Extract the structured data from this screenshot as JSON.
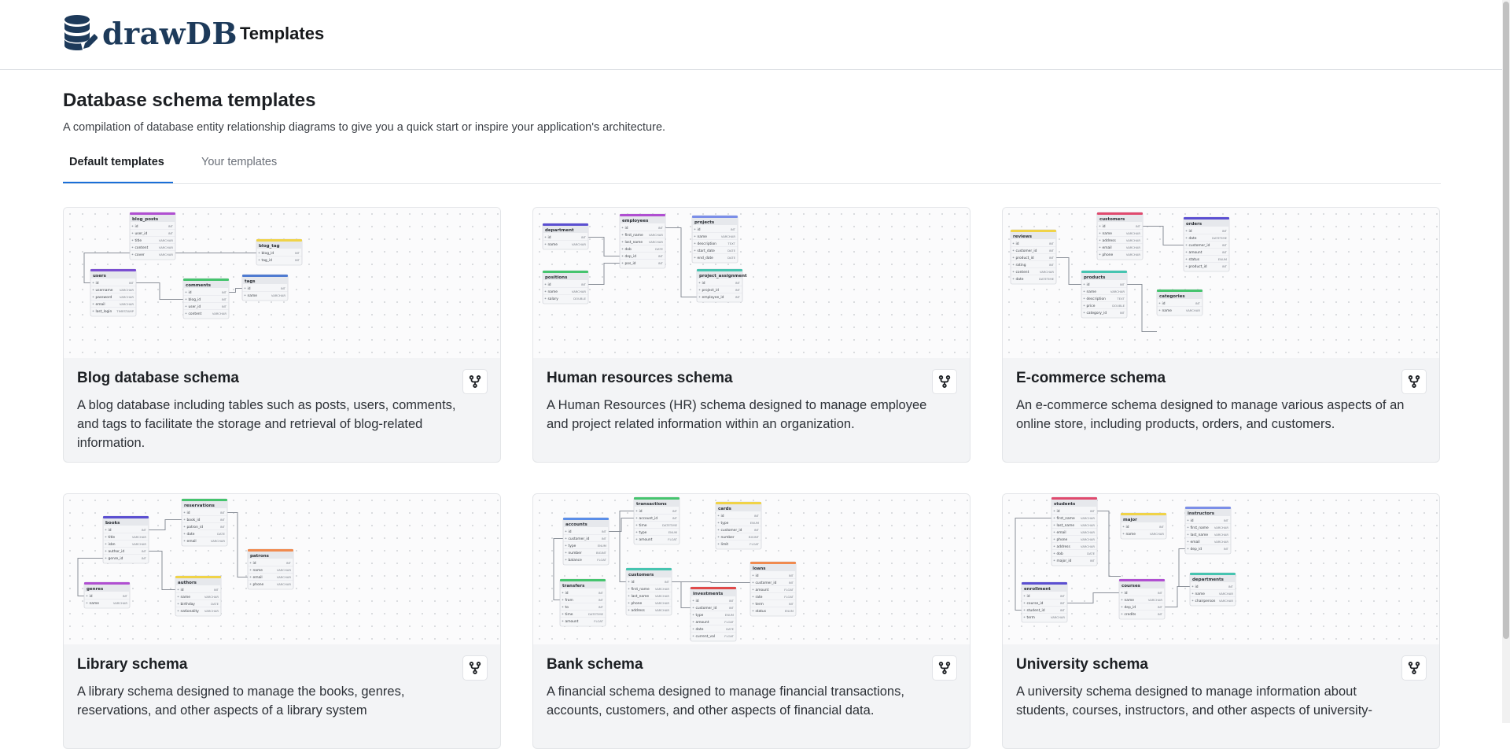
{
  "header": {
    "logo_text": "drawDB",
    "nav_title": "Templates"
  },
  "page": {
    "title": "Database schema templates",
    "subtitle": "A compilation of database entity relationship diagrams to give you a quick start or inspire your application's architecture."
  },
  "tabs": [
    {
      "label": "Default templates",
      "active": true
    },
    {
      "label": "Your templates",
      "active": false
    }
  ],
  "colors": {
    "accent": "#1a6fd8",
    "brand": "#1d3a5a"
  },
  "cards": [
    {
      "title": "Blog database schema",
      "description": "A blog database including tables such as posts, users, comments, and tags to facilitate the storage and retrieval of blog-related information.",
      "action_icon": "fork-icon",
      "tables": [
        {
          "name": "blog_posts",
          "color": "#b04fd1",
          "fields": [
            [
              "id",
              "INT"
            ],
            [
              "user_id",
              "INT"
            ],
            [
              "title",
              "VARCHAR"
            ],
            [
              "content",
              "VARCHAR"
            ],
            [
              "cover",
              "VARCHAR"
            ]
          ]
        },
        {
          "name": "blog_tag",
          "color": "#f0d348",
          "fields": [
            [
              "blog_id",
              "INT"
            ],
            [
              "tag_id",
              "INT"
            ]
          ]
        },
        {
          "name": "users",
          "color": "#7b4fd1",
          "fields": [
            [
              "id",
              "INT"
            ],
            [
              "username",
              "VARCHAR"
            ],
            [
              "password",
              "VARCHAR"
            ],
            [
              "email",
              "VARCHAR"
            ],
            [
              "last_login",
              "TIMESTAMP"
            ]
          ]
        },
        {
          "name": "comments",
          "color": "#46c46e",
          "fields": [
            [
              "id",
              "INT"
            ],
            [
              "blog_id",
              "INT"
            ],
            [
              "user_id",
              "INT"
            ],
            [
              "content",
              "VARCHAR"
            ]
          ]
        },
        {
          "name": "tags",
          "color": "#4f7bd1",
          "fields": [
            [
              "id",
              "INT"
            ],
            [
              "name",
              "VARCHAR"
            ]
          ]
        }
      ]
    },
    {
      "title": "Human resources schema",
      "description": "A Human Resources (HR) schema designed to manage employee and project related information within an organization.",
      "action_icon": "fork-icon",
      "tables": [
        {
          "name": "department",
          "color": "#5b4fd1",
          "fields": [
            [
              "id",
              "INT"
            ],
            [
              "name",
              "VARCHAR"
            ]
          ]
        },
        {
          "name": "employees",
          "color": "#b04fd1",
          "fields": [
            [
              "id",
              "INT"
            ],
            [
              "first_name",
              "VARCHAR"
            ],
            [
              "last_name",
              "VARCHAR"
            ],
            [
              "dob",
              "DATE"
            ],
            [
              "dep_id",
              "INT"
            ],
            [
              "pos_id",
              "INT"
            ]
          ]
        },
        {
          "name": "projects",
          "color": "#7b8ee8",
          "fields": [
            [
              "id",
              "INT"
            ],
            [
              "name",
              "VARCHAR"
            ],
            [
              "description",
              "TEXT"
            ],
            [
              "start_date",
              "DATE"
            ],
            [
              "end_date",
              "DATE"
            ]
          ]
        },
        {
          "name": "positions",
          "color": "#46c46e",
          "fields": [
            [
              "id",
              "INT"
            ],
            [
              "name",
              "VARCHAR"
            ],
            [
              "salary",
              "DOUBLE"
            ]
          ]
        },
        {
          "name": "project_assignment",
          "color": "#46c4b0",
          "fields": [
            [
              "id",
              "INT"
            ],
            [
              "project_id",
              "INT"
            ],
            [
              "employee_id",
              "INT"
            ]
          ]
        }
      ]
    },
    {
      "title": "E-commerce schema",
      "description": "An e-commerce schema designed to manage various aspects of an online store, including products, orders, and customers.",
      "action_icon": "fork-icon",
      "tables": [
        {
          "name": "customers",
          "color": "#e04a6e",
          "fields": [
            [
              "id",
              "INT"
            ],
            [
              "name",
              "VARCHAR"
            ],
            [
              "address",
              "VARCHAR"
            ],
            [
              "email",
              "VARCHAR"
            ],
            [
              "phone",
              "VARCHAR"
            ]
          ]
        },
        {
          "name": "orders",
          "color": "#5b4fd1",
          "fields": [
            [
              "id",
              "INT"
            ],
            [
              "date",
              "DATETIME"
            ],
            [
              "customer_id",
              "INT"
            ],
            [
              "amount",
              "INT"
            ],
            [
              "status",
              "ENUM"
            ],
            [
              "product_id",
              "INT"
            ]
          ]
        },
        {
          "name": "reviews",
          "color": "#f0d348",
          "fields": [
            [
              "id",
              "INT"
            ],
            [
              "customer_id",
              "INT"
            ],
            [
              "product_id",
              "INT"
            ],
            [
              "rating",
              "INT"
            ],
            [
              "content",
              "VARCHAR"
            ],
            [
              "date",
              "DATETIME"
            ]
          ]
        },
        {
          "name": "products",
          "color": "#46c4b0",
          "fields": [
            [
              "id",
              "INT"
            ],
            [
              "name",
              "VARCHAR"
            ],
            [
              "description",
              "TEXT"
            ],
            [
              "price",
              "DOUBLE"
            ],
            [
              "category_id",
              "INT"
            ]
          ]
        },
        {
          "name": "categories",
          "color": "#46c46e",
          "fields": [
            [
              "id",
              "INT"
            ],
            [
              "name",
              "VARCHAR"
            ]
          ]
        }
      ]
    },
    {
      "title": "Library schema",
      "description": "A library schema designed to manage the books, genres, reservations, and other aspects of a library system",
      "action_icon": "fork-icon",
      "tables": [
        {
          "name": "reservations",
          "color": "#46c46e",
          "fields": [
            [
              "id",
              "INT"
            ],
            [
              "book_id",
              "INT"
            ],
            [
              "patron_id",
              "INT"
            ],
            [
              "date",
              "DATE"
            ],
            [
              "email",
              "VARCHAR"
            ]
          ]
        },
        {
          "name": "books",
          "color": "#5b4fd1",
          "fields": [
            [
              "id",
              "INT"
            ],
            [
              "title",
              "VARCHAR"
            ],
            [
              "isbn",
              "VARCHAR"
            ],
            [
              "author_id",
              "INT"
            ],
            [
              "genre_id",
              "INT"
            ]
          ]
        },
        {
          "name": "patrons",
          "color": "#f08a4f",
          "fields": [
            [
              "id",
              "INT"
            ],
            [
              "name",
              "VARCHAR"
            ],
            [
              "email",
              "VARCHAR"
            ],
            [
              "phone",
              "VARCHAR"
            ]
          ]
        },
        {
          "name": "authors",
          "color": "#f0d348",
          "fields": [
            [
              "id",
              "INT"
            ],
            [
              "name",
              "VARCHAR"
            ],
            [
              "birthday",
              "DATE"
            ],
            [
              "nationality",
              "VARCHAR"
            ]
          ]
        },
        {
          "name": "genres",
          "color": "#b04fd1",
          "fields": [
            [
              "id",
              "INT"
            ],
            [
              "name",
              "VARCHAR"
            ]
          ]
        }
      ]
    },
    {
      "title": "Bank schema",
      "description": "A financial schema designed to manage financial transactions, accounts, customers, and other aspects of financial data.",
      "action_icon": "fork-icon",
      "tables": [
        {
          "name": "transactions",
          "color": "#46c46e",
          "fields": [
            [
              "id",
              "INT"
            ],
            [
              "account_id",
              "INT"
            ],
            [
              "time",
              "DATETIME"
            ],
            [
              "type",
              "ENUM"
            ],
            [
              "amount",
              "FLOAT"
            ]
          ]
        },
        {
          "name": "accounts",
          "color": "#5b8ee8",
          "fields": [
            [
              "id",
              "INT"
            ],
            [
              "customer_id",
              "INT"
            ],
            [
              "type",
              "ENUM"
            ],
            [
              "number",
              "BIGINT"
            ],
            [
              "balance",
              "FLOAT"
            ]
          ]
        },
        {
          "name": "cards",
          "color": "#f0d348",
          "fields": [
            [
              "id",
              "INT"
            ],
            [
              "type",
              "ENUM"
            ],
            [
              "customer_id",
              "INT"
            ],
            [
              "number",
              "BIGINT"
            ],
            [
              "limit",
              "FLOAT"
            ]
          ]
        },
        {
          "name": "customers",
          "color": "#46c4b0",
          "fields": [
            [
              "id",
              "INT"
            ],
            [
              "first_name",
              "VARCHAR"
            ],
            [
              "last_name",
              "VARCHAR"
            ],
            [
              "phone",
              "VARCHAR"
            ],
            [
              "address",
              "VARCHAR"
            ]
          ]
        },
        {
          "name": "loans",
          "color": "#f08a4f",
          "fields": [
            [
              "id",
              "INT"
            ],
            [
              "customer_id",
              "INT"
            ],
            [
              "amount",
              "FLOAT"
            ],
            [
              "rate",
              "FLOAT"
            ],
            [
              "term",
              "INT"
            ],
            [
              "status",
              "ENUM"
            ]
          ]
        },
        {
          "name": "transfers",
          "color": "#46c46e",
          "fields": [
            [
              "id",
              "INT"
            ],
            [
              "from",
              "INT"
            ],
            [
              "to",
              "INT"
            ],
            [
              "time",
              "DATETIME"
            ],
            [
              "amount",
              "FLOAT"
            ]
          ]
        },
        {
          "name": "investments",
          "color": "#e04a4a",
          "fields": [
            [
              "id",
              "INT"
            ],
            [
              "customer_id",
              "INT"
            ],
            [
              "type",
              "ENUM"
            ],
            [
              "amount",
              "FLOAT"
            ],
            [
              "date",
              "DATE"
            ],
            [
              "current_val",
              "FLOAT"
            ]
          ]
        }
      ]
    },
    {
      "title": "University schema",
      "description": "A university schema designed to manage information about students, courses, instructors, and other aspects of university-",
      "action_icon": "fork-icon",
      "tables": [
        {
          "name": "students",
          "color": "#e04a6e",
          "fields": [
            [
              "id",
              "INT"
            ],
            [
              "first_name",
              "VARCHAR"
            ],
            [
              "last_name",
              "VARCHAR"
            ],
            [
              "email",
              "VARCHAR"
            ],
            [
              "phone",
              "VARCHAR"
            ],
            [
              "address",
              "VARCHAR"
            ],
            [
              "dob",
              "DATE"
            ],
            [
              "major_id",
              "INT"
            ]
          ]
        },
        {
          "name": "major",
          "color": "#f0d348",
          "fields": [
            [
              "id",
              "INT"
            ],
            [
              "name",
              "VARCHAR"
            ]
          ]
        },
        {
          "name": "instructors",
          "color": "#7b8ee8",
          "fields": [
            [
              "id",
              "INT"
            ],
            [
              "first_name",
              "VARCHAR"
            ],
            [
              "last_name",
              "VARCHAR"
            ],
            [
              "email",
              "VARCHAR"
            ],
            [
              "dep_id",
              "INT"
            ]
          ]
        },
        {
          "name": "enrollment",
          "color": "#5b4fd1",
          "fields": [
            [
              "id",
              "INT"
            ],
            [
              "course_id",
              "INT"
            ],
            [
              "student_id",
              "INT"
            ],
            [
              "term",
              "VARCHAR"
            ]
          ]
        },
        {
          "name": "courses",
          "color": "#b04fd1",
          "fields": [
            [
              "id",
              "INT"
            ],
            [
              "name",
              "VARCHAR"
            ],
            [
              "dep_id",
              "INT"
            ],
            [
              "credits",
              "INT"
            ]
          ]
        },
        {
          "name": "departments",
          "color": "#46c4b0",
          "fields": [
            [
              "id",
              "INT"
            ],
            [
              "name",
              "VARCHAR"
            ],
            [
              "chairperson",
              "VARCHAR"
            ]
          ]
        }
      ]
    }
  ]
}
